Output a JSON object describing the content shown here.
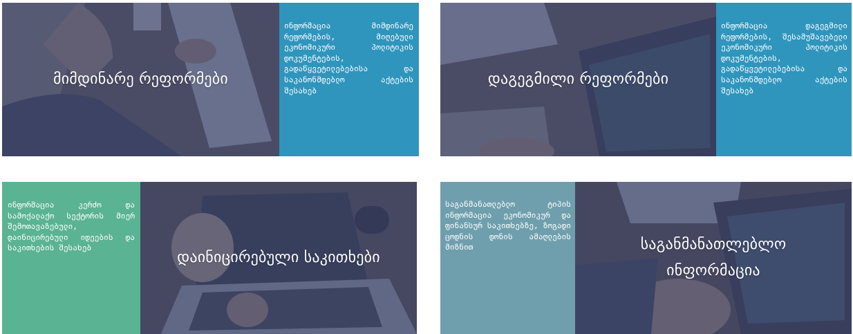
{
  "cards": [
    {
      "title": "მიმდინარე რეფორმები",
      "description": "ინფორმაცია მიმდინარე რეფორმების, მიღებული ეკონომიკური პოლიტიკის დოკუმენტების, გადაწყვეტილებებისა და საკანონმდებლო აქტების შესახებ",
      "panel_color": "#2f95bd"
    },
    {
      "title": "დაგეგმილი რეფორმები",
      "description": "ინფორმაცია დაგეგმილი რეფორმების, შესამუშავებელი ეკონომიკური პოლიტიკის დოკუმენტების, გადაწყვეტილებებისა და საკანონმდებლო აქტების შესახებ",
      "panel_color": "#2f95bd"
    },
    {
      "title": "დაინიცირებული საკითხები",
      "description": "ინფორმაცია კერძო და სამოქალაქო სექტორის მიერ შემოთავაზებული, დაინიცირებული იდეების და საკითხების შესახებ",
      "panel_color": "#5ab393"
    },
    {
      "title": "საგანმანათლებლო ინფორმაცია",
      "description": "საგანმანათლებლო ტიპის ინფორმაცია ეკონომიკურ და ფინანსურ საკითხებზე, ზოგადი ცოდნის დონის ამაღლების მიზნით",
      "panel_color": "#6f9fad"
    }
  ],
  "overlay_color": "#3d456c"
}
